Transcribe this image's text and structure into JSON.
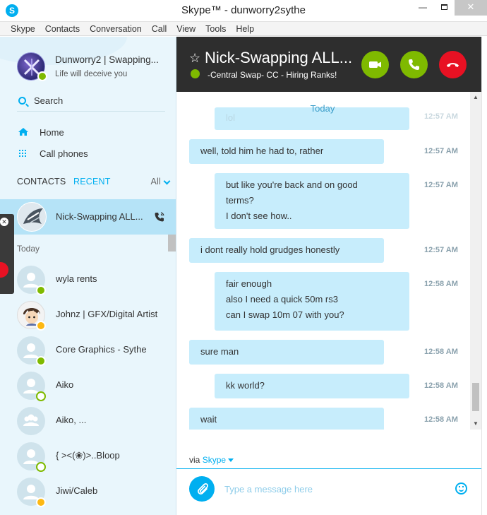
{
  "window": {
    "title": "Skype™ - dunworry2sythe",
    "min": "—",
    "close": "✕"
  },
  "menu": [
    "Skype",
    "Contacts",
    "Conversation",
    "Call",
    "View",
    "Tools",
    "Help"
  ],
  "profile": {
    "name": "Dunworry2 | Swapping...",
    "mood": "Life will deceive you"
  },
  "search": {
    "label": "Search"
  },
  "nav": {
    "home": "Home",
    "calls": "Call phones"
  },
  "tabs": {
    "contacts": "CONTACTS",
    "recent": "RECENT",
    "all": "All"
  },
  "active_contact": {
    "name": "Nick-Swapping ALL..."
  },
  "section": {
    "today": "Today"
  },
  "contacts": [
    {
      "name": "wyla rents",
      "status": "online"
    },
    {
      "name": "Johnz | GFX/Digital Artist",
      "status": "away"
    },
    {
      "name": "Core Graphics - Sythe",
      "status": "online"
    },
    {
      "name": "Aiko",
      "status": "offline"
    },
    {
      "name": "Aiko, ...",
      "status": "group"
    },
    {
      "name": "{ ><(❀)>..Bloop",
      "status": "offline"
    },
    {
      "name": "Jiwi/Caleb",
      "status": "away"
    }
  ],
  "overlay": {
    "close": "✕"
  },
  "conversation": {
    "title": "Nick-Swapping ALL...",
    "subtitle": "-Central Swap- CC - Hiring Ranks!",
    "star": "☆",
    "day_label": "Today",
    "partial_text": "lol",
    "partial_time": "12:57 AM",
    "messages": [
      {
        "side": "them",
        "lines": [
          "well, told him he had to, rather"
        ],
        "time": "12:57 AM"
      },
      {
        "side": "me",
        "lines": [
          "but like you're back and on good",
          "terms?",
          "I don't see how.."
        ],
        "time": "12:57 AM"
      },
      {
        "side": "them",
        "lines": [
          "i dont really hold grudges honestly"
        ],
        "time": "12:57 AM"
      },
      {
        "side": "me",
        "lines": [
          "fair enough",
          "also I need a quick 50m rs3",
          "can I swap 10m 07 with you?"
        ],
        "time": "12:58 AM"
      },
      {
        "side": "them",
        "lines": [
          "sure man"
        ],
        "time": "12:58 AM"
      },
      {
        "side": "me",
        "lines": [
          "kk world?"
        ],
        "time": "12:58 AM"
      },
      {
        "side": "them",
        "lines": [
          "wait"
        ],
        "time": "12:58 AM"
      }
    ]
  },
  "compose": {
    "via_prefix": "via",
    "via_service": "Skype",
    "placeholder": "Type a message here"
  },
  "colors": {
    "accent": "#00aff0",
    "online": "#7fba00",
    "away": "#fdb813",
    "end_call": "#e81123",
    "bubble": "#c7edfc",
    "header_bg": "#2e2e2e"
  }
}
